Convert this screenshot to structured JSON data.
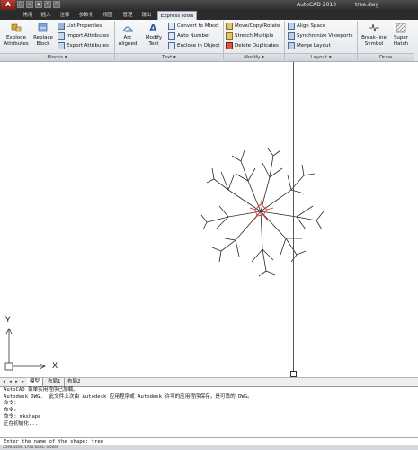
{
  "app": {
    "title": "AutoCAD 2010",
    "file": "tree.dwg",
    "menu_button": "A"
  },
  "tabs": [
    {
      "label": "常用"
    },
    {
      "label": "插入"
    },
    {
      "label": "注释"
    },
    {
      "label": "参数化"
    },
    {
      "label": "视图"
    },
    {
      "label": "管理"
    },
    {
      "label": "输出"
    },
    {
      "label": "Express Tools"
    }
  ],
  "ribbon": {
    "blocks": {
      "label": "Blocks ▾",
      "explode": "Explode\nAttributes",
      "replace": "Replace\nBlock",
      "list_properties": "List Properties",
      "import_attributes": "Import Attributes",
      "export_attributes": "Export Attributes"
    },
    "text": {
      "label": "Text ▾",
      "arc_aligned": "Arc\nAligned",
      "modify_text": "Modify\nText",
      "convert_mtext": "Convert to Mtext",
      "auto_number": "Auto Number",
      "enclose_object": "Enclose in Object"
    },
    "modify": {
      "label": "Modify ▾",
      "move_copy_rotate": "Move/Copy/Rotate",
      "stretch_multiple": "Stretch Multiple",
      "delete_duplicates": "Delete Duplicates"
    },
    "layout": {
      "label": "Layout ▾",
      "align_space": "Align Space",
      "sync_viewports": "Synchronize Viewports",
      "merge_layout": "Merge Layout"
    },
    "draw": {
      "label": "Draw",
      "break_line": "Break-line\nSymbol",
      "super_hatch": "Super\nHatch"
    }
  },
  "ucs": {
    "y_label": "Y",
    "x_label": "X"
  },
  "layout_tabs": [
    {
      "label": "模型"
    },
    {
      "label": "布局1"
    },
    {
      "label": "布局2"
    }
  ],
  "command_history": [
    "AutoCAD 菜单实用程序已加载。",
    "Autodesk DWG.  此文件上次由 Autodesk 应用程序或 Autodesk 许可的应用程序保存，是可靠的 DWG。",
    "命令:",
    "命令:",
    "命令: mkshape",
    "正在初始化..."
  ],
  "command_prompt": "Enter the name of the shape: tree",
  "status": "2596.4539, 1706.0000, 0.0000"
}
